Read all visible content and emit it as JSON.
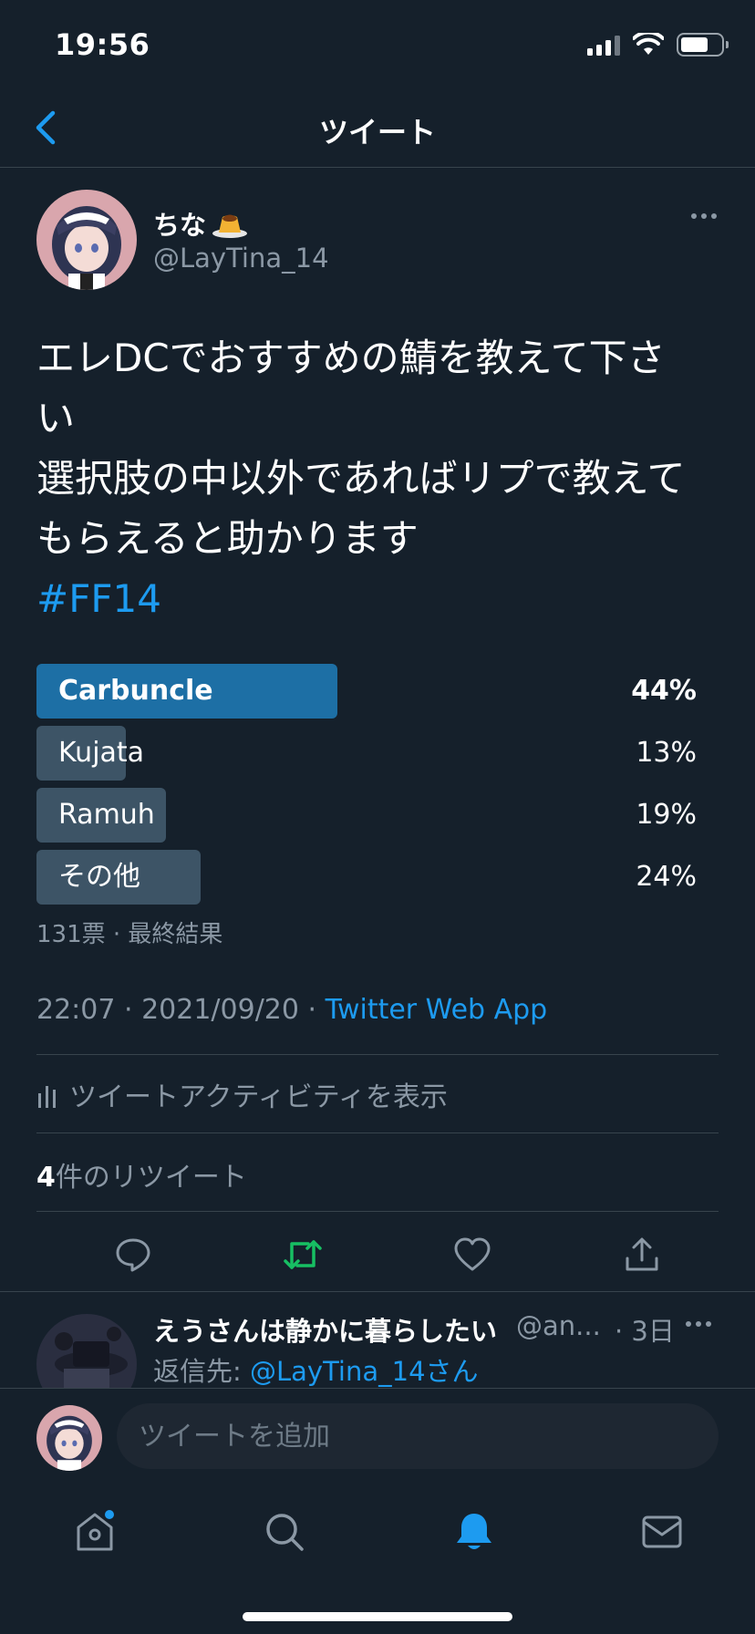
{
  "status_bar": {
    "time": "19:56"
  },
  "header": {
    "title": "ツイート"
  },
  "tweet": {
    "author_name": "ちな",
    "author_handle": "@LayTina_14",
    "text_lines": [
      "エレDCでおすすめの鯖を教えて下さ",
      "い",
      "選択肢の中以外であればリプで教えて",
      "もらえると助かります"
    ],
    "hashtag": "#FF14",
    "poll": {
      "options": [
        {
          "label": "Carbuncle",
          "percent": 44,
          "percent_text": "44%",
          "winner": true
        },
        {
          "label": "Kujata",
          "percent": 13,
          "percent_text": "13%",
          "winner": false
        },
        {
          "label": "Ramuh",
          "percent": 19,
          "percent_text": "19%",
          "winner": false
        },
        {
          "label": "その他",
          "percent": 24,
          "percent_text": "24%",
          "winner": false
        }
      ],
      "meta": "131票 · 最終結果"
    },
    "timestamp": "22:07 · 2021/09/20 · ",
    "source": "Twitter Web App",
    "activity_label": "ツイートアクティビティを表示",
    "retweet_count": "4",
    "retweet_label": "件のリツイート"
  },
  "reply": {
    "name": "えうさんは静かに暮らしたい",
    "handle": "@an...",
    "time": "· 3日",
    "reply_to_prefix": "返信先: ",
    "reply_to_mention": "@LayTina_14さん"
  },
  "composer": {
    "placeholder": "ツイートを追加"
  },
  "colors": {
    "background": "#15202b",
    "accent": "#1d9bf0",
    "retweet_green": "#17bf63",
    "poll_winner": "#1d6fa5",
    "poll_other": "#3d5466",
    "muted": "#8b98a5"
  },
  "icons": {
    "back": "chevron-left-icon",
    "reply": "speech-bubble-icon",
    "retweet": "retweet-icon",
    "like": "heart-icon",
    "share": "share-icon",
    "home": "home-icon",
    "search": "search-icon",
    "notifications": "bell-icon",
    "messages": "mail-icon"
  }
}
